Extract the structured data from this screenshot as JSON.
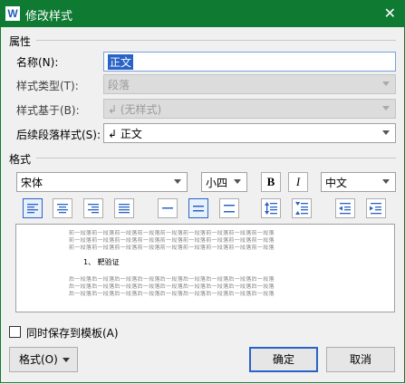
{
  "dialog": {
    "title": "修改样式",
    "app_icon_letter": "W",
    "close_symbol": "✕"
  },
  "properties": {
    "section_label": "属性",
    "name_label": "名称(N):",
    "name_value": "正文",
    "style_type_label": "样式类型(T):",
    "style_type_value": "段落",
    "based_on_label": "样式基于(B):",
    "based_on_value": "↲ (无样式)",
    "following_label": "后续段落样式(S):",
    "following_value": "↲ 正文"
  },
  "format": {
    "section_label": "格式",
    "font": "宋体",
    "size": "小四",
    "bold": "B",
    "italic": "I",
    "language": "中文"
  },
  "preview": {
    "previous_paragraph_text": "前一段落前一段落前一段落前一段落前一段落前一段落前一段落前一段落前一段落",
    "sample_text": "1、 靶验证",
    "next_paragraph_text": "后一段落后一段落后一段落后一段落后一段落后一段落后一段落后一段落后一段落"
  },
  "template_checkbox": {
    "label": "同时保存到模板(A)",
    "checked": false
  },
  "buttons": {
    "format_menu": "格式(O)",
    "ok": "确定",
    "cancel": "取消"
  },
  "colors": {
    "titlebar": "#0e7a32",
    "selection": "#2a63c6",
    "icon_blue": "#2a63c6"
  }
}
